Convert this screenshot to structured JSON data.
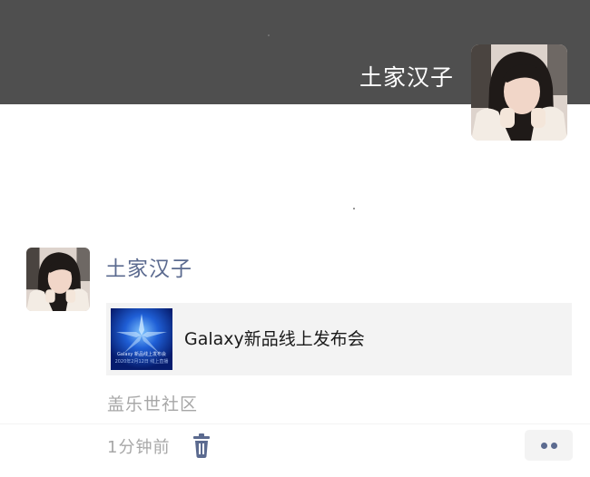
{
  "cover": {
    "username": "土家汉子"
  },
  "post": {
    "author": "土家汉子",
    "link": {
      "title": "Galaxy新品线上发布会",
      "thumb_line1": "Galaxy 新品线上发布会",
      "thumb_line2": "2020年2月12日 线上直播"
    },
    "location": "盖乐世社区",
    "time": "1分钟前"
  },
  "icons": {
    "delete": "trash-icon",
    "more": "more-dots-icon"
  },
  "colors": {
    "cover_bg": "#4f4f4f",
    "name_link": "#5b6a8f",
    "meta_gray": "#a7a7a7",
    "card_bg": "#f3f3f3"
  }
}
